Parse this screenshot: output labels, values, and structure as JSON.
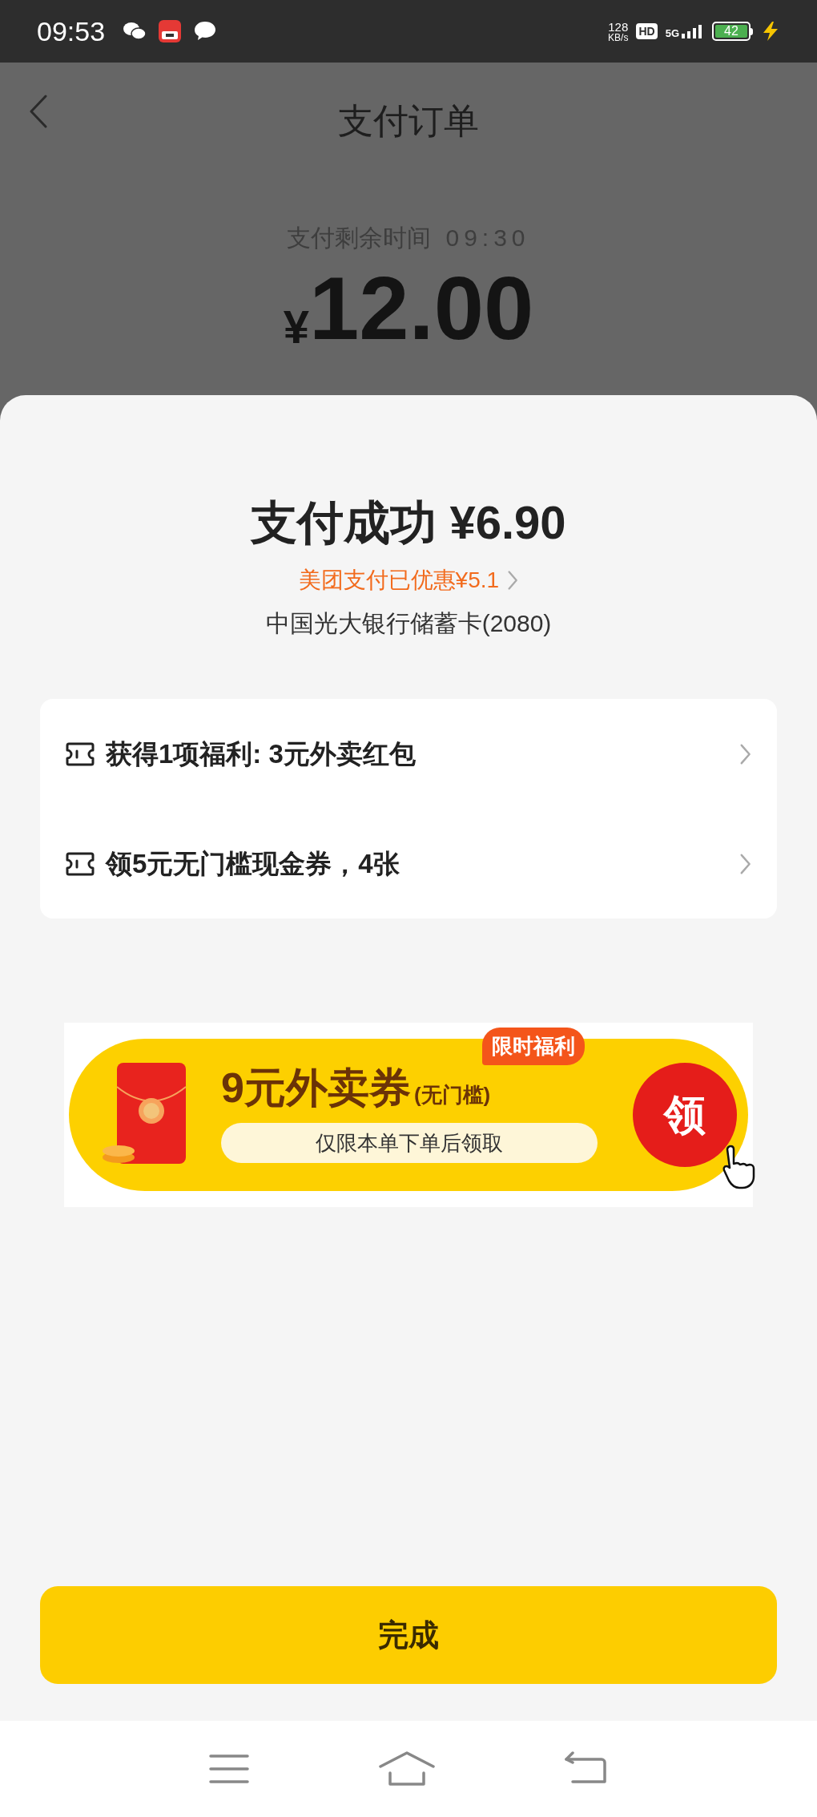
{
  "status_bar": {
    "time": "09:53",
    "speed": "128",
    "speed_unit": "KB/s",
    "hd": "HD",
    "network": "5G",
    "battery": "42",
    "charging": true
  },
  "header": {
    "title": "支付订单",
    "countdown_label": "支付剩余时间",
    "countdown": "09:30",
    "currency": "¥",
    "amount": "12.00"
  },
  "result": {
    "title": "支付成功 ¥6.90",
    "discount": "美团支付已优惠¥5.1",
    "card": "中国光大银行储蓄卡(2080)"
  },
  "benefits": [
    {
      "text": "获得1项福利: 3元外卖红包"
    },
    {
      "text": "领5元无门槛现金券，4张"
    }
  ],
  "banner": {
    "tag": "限时福利",
    "title": "9元外卖券",
    "note": "(无门槛)",
    "subtitle": "仅限本单下单后领取",
    "action": "领"
  },
  "done_button": "完成"
}
